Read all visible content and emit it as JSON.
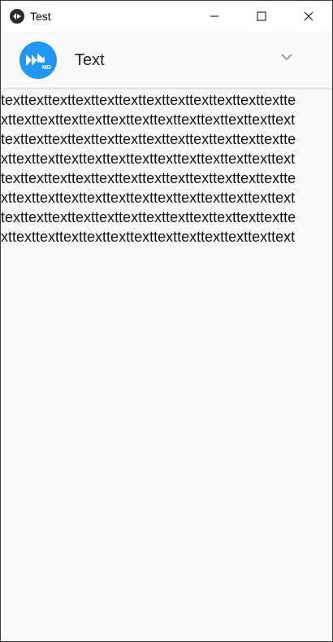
{
  "window": {
    "title": "Test",
    "minimize_icon": "minimize-icon",
    "maximize_icon": "maximize-icon",
    "close_icon": "close-icon"
  },
  "header": {
    "avatar_badge": "MD",
    "avatar_icon": "kivymd-logo-icon",
    "label": "Text",
    "dropdown_icon": "chevron-down-icon",
    "accent_color": "#2196F3"
  },
  "content": {
    "lines": [
      "texttexttexttexttexttexttexttexttexttexttexttextte",
      "xttexttexttexttexttexttexttexttexttexttexttexttext",
      "texttexttexttexttexttexttexttexttexttexttexttextte",
      "xttexttexttexttexttexttexttexttexttexttexttexttext",
      "texttexttexttexttexttexttexttexttexttexttexttextte",
      "xttexttexttexttexttexttexttexttexttexttexttexttext",
      "texttexttexttexttexttexttexttexttexttexttexttextte",
      "xttexttexttexttexttexttexttexttexttexttexttexttext"
    ]
  }
}
